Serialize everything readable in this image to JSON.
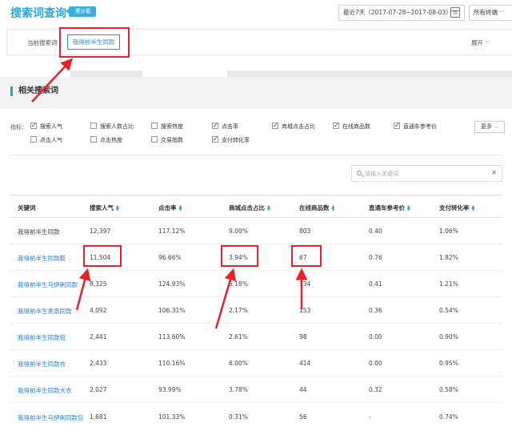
{
  "header": {
    "title": "搜索词查询",
    "badge": "累计看",
    "date_range": "最近7天（2017-07-28~2017-08-03）",
    "calendar_day": "15",
    "category_select": "所有终端"
  },
  "current_term": {
    "label": "当前搜索词",
    "value": "我得前半生同款",
    "expand_label": "展开"
  },
  "section_title": "相关搜索词",
  "metrics": {
    "label": "指标：",
    "options": [
      {
        "label": "搜索人气",
        "checked": true
      },
      {
        "label": "搜索人数占比",
        "checked": false
      },
      {
        "label": "搜索热度",
        "checked": false
      },
      {
        "label": "点击率",
        "checked": true
      },
      {
        "label": "商城点击占比",
        "checked": true
      },
      {
        "label": "在线商品数",
        "checked": true
      },
      {
        "label": "直通车参考价",
        "checked": true
      },
      {
        "label": "点击人气",
        "checked": false
      },
      {
        "label": "点击热度",
        "checked": false
      },
      {
        "label": "交易指数",
        "checked": false
      },
      {
        "label": "支付转化率",
        "checked": true
      }
    ],
    "more_label": "更多"
  },
  "search": {
    "placeholder": "请输入关键词"
  },
  "table": {
    "headers": [
      "关键词",
      "搜索人气",
      "点击率",
      "商城点击占比",
      "在线商品数",
      "直通车参考价",
      "支付转化率"
    ],
    "rows": [
      [
        "我得前半生同款",
        "12,397",
        "117.12%",
        "9.00%",
        "803",
        "0.40",
        "1.06%"
      ],
      [
        "我得前半生同款鞋",
        "11,504",
        "96.66%",
        "3.94%",
        "67",
        "0.76",
        "1.82%"
      ],
      [
        "我得前半生马伊俐同款",
        "8,325",
        "124.93%",
        "6.18%",
        "334",
        "0.41",
        "1.21%"
      ],
      [
        "我得前半生袁泉同款",
        "4,092",
        "106.31%",
        "2.17%",
        "153",
        "0.36",
        "0.54%"
      ],
      [
        "我得前半生同款包",
        "2,441",
        "113.60%",
        "2.61%",
        "98",
        "0.00",
        "0.90%"
      ],
      [
        "我得前半生同款衣",
        "2,433",
        "110.16%",
        "6.00%",
        "414",
        "0.00",
        "0.95%"
      ],
      [
        "我得前半生同款大衣",
        "2,027",
        "93.99%",
        "3.78%",
        "44",
        "0.32",
        "0.58%"
      ],
      [
        "我得前半生马伊俐同款包",
        "1,681",
        "101.33%",
        "0.31%",
        "56",
        "-",
        "0.74%"
      ]
    ]
  },
  "colors": {
    "accent": "#29a7d8",
    "link": "#2a7fc9",
    "highlight": "#e8222a",
    "section_marker": "#1ab394"
  }
}
